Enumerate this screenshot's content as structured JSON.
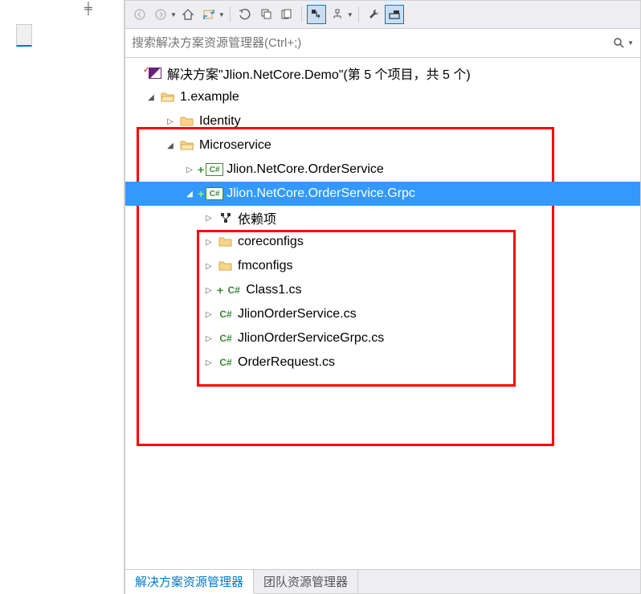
{
  "toolbar": {
    "back": "◄",
    "forward": "►",
    "home": "⌂",
    "sync": "⟳",
    "undo": "↶",
    "collapse": "⊟",
    "showall": "⊞",
    "wrench": "🔧"
  },
  "search": {
    "placeholder": "搜索解决方案资源管理器(Ctrl+;)"
  },
  "tree": {
    "solution": "解决方案\"Jlion.NetCore.Demo\"(第 5 个项目，共 5 个)",
    "example": "1.example",
    "identity": "Identity",
    "microservice": "Microservice",
    "orderservice": "Jlion.NetCore.OrderService",
    "orderservice_grpc": "Jlion.NetCore.OrderService.Grpc",
    "deps": "依赖项",
    "coreconfigs": "coreconfigs",
    "fmconfigs": "fmconfigs",
    "class1": "Class1.cs",
    "jlionorderservice": "JlionOrderService.cs",
    "jlionorderservicegrpc": "JlionOrderServiceGrpc.cs",
    "orderrequest": "OrderRequest.cs"
  },
  "tabs": {
    "solution_explorer": "解决方案资源管理器",
    "team_explorer": "团队资源管理器"
  }
}
